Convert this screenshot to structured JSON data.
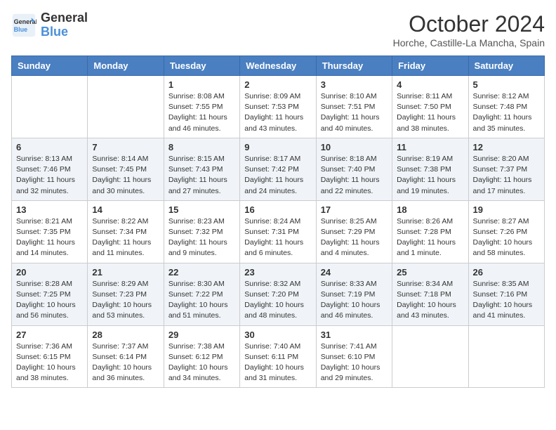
{
  "header": {
    "logo_line1": "General",
    "logo_line2": "Blue",
    "month_title": "October 2024",
    "location": "Horche, Castille-La Mancha, Spain"
  },
  "weekdays": [
    "Sunday",
    "Monday",
    "Tuesday",
    "Wednesday",
    "Thursday",
    "Friday",
    "Saturday"
  ],
  "weeks": [
    [
      {
        "day": "",
        "info": ""
      },
      {
        "day": "",
        "info": ""
      },
      {
        "day": "1",
        "info": "Sunrise: 8:08 AM\nSunset: 7:55 PM\nDaylight: 11 hours and 46 minutes."
      },
      {
        "day": "2",
        "info": "Sunrise: 8:09 AM\nSunset: 7:53 PM\nDaylight: 11 hours and 43 minutes."
      },
      {
        "day": "3",
        "info": "Sunrise: 8:10 AM\nSunset: 7:51 PM\nDaylight: 11 hours and 40 minutes."
      },
      {
        "day": "4",
        "info": "Sunrise: 8:11 AM\nSunset: 7:50 PM\nDaylight: 11 hours and 38 minutes."
      },
      {
        "day": "5",
        "info": "Sunrise: 8:12 AM\nSunset: 7:48 PM\nDaylight: 11 hours and 35 minutes."
      }
    ],
    [
      {
        "day": "6",
        "info": "Sunrise: 8:13 AM\nSunset: 7:46 PM\nDaylight: 11 hours and 32 minutes."
      },
      {
        "day": "7",
        "info": "Sunrise: 8:14 AM\nSunset: 7:45 PM\nDaylight: 11 hours and 30 minutes."
      },
      {
        "day": "8",
        "info": "Sunrise: 8:15 AM\nSunset: 7:43 PM\nDaylight: 11 hours and 27 minutes."
      },
      {
        "day": "9",
        "info": "Sunrise: 8:17 AM\nSunset: 7:42 PM\nDaylight: 11 hours and 24 minutes."
      },
      {
        "day": "10",
        "info": "Sunrise: 8:18 AM\nSunset: 7:40 PM\nDaylight: 11 hours and 22 minutes."
      },
      {
        "day": "11",
        "info": "Sunrise: 8:19 AM\nSunset: 7:38 PM\nDaylight: 11 hours and 19 minutes."
      },
      {
        "day": "12",
        "info": "Sunrise: 8:20 AM\nSunset: 7:37 PM\nDaylight: 11 hours and 17 minutes."
      }
    ],
    [
      {
        "day": "13",
        "info": "Sunrise: 8:21 AM\nSunset: 7:35 PM\nDaylight: 11 hours and 14 minutes."
      },
      {
        "day": "14",
        "info": "Sunrise: 8:22 AM\nSunset: 7:34 PM\nDaylight: 11 hours and 11 minutes."
      },
      {
        "day": "15",
        "info": "Sunrise: 8:23 AM\nSunset: 7:32 PM\nDaylight: 11 hours and 9 minutes."
      },
      {
        "day": "16",
        "info": "Sunrise: 8:24 AM\nSunset: 7:31 PM\nDaylight: 11 hours and 6 minutes."
      },
      {
        "day": "17",
        "info": "Sunrise: 8:25 AM\nSunset: 7:29 PM\nDaylight: 11 hours and 4 minutes."
      },
      {
        "day": "18",
        "info": "Sunrise: 8:26 AM\nSunset: 7:28 PM\nDaylight: 11 hours and 1 minute."
      },
      {
        "day": "19",
        "info": "Sunrise: 8:27 AM\nSunset: 7:26 PM\nDaylight: 10 hours and 58 minutes."
      }
    ],
    [
      {
        "day": "20",
        "info": "Sunrise: 8:28 AM\nSunset: 7:25 PM\nDaylight: 10 hours and 56 minutes."
      },
      {
        "day": "21",
        "info": "Sunrise: 8:29 AM\nSunset: 7:23 PM\nDaylight: 10 hours and 53 minutes."
      },
      {
        "day": "22",
        "info": "Sunrise: 8:30 AM\nSunset: 7:22 PM\nDaylight: 10 hours and 51 minutes."
      },
      {
        "day": "23",
        "info": "Sunrise: 8:32 AM\nSunset: 7:20 PM\nDaylight: 10 hours and 48 minutes."
      },
      {
        "day": "24",
        "info": "Sunrise: 8:33 AM\nSunset: 7:19 PM\nDaylight: 10 hours and 46 minutes."
      },
      {
        "day": "25",
        "info": "Sunrise: 8:34 AM\nSunset: 7:18 PM\nDaylight: 10 hours and 43 minutes."
      },
      {
        "day": "26",
        "info": "Sunrise: 8:35 AM\nSunset: 7:16 PM\nDaylight: 10 hours and 41 minutes."
      }
    ],
    [
      {
        "day": "27",
        "info": "Sunrise: 7:36 AM\nSunset: 6:15 PM\nDaylight: 10 hours and 38 minutes."
      },
      {
        "day": "28",
        "info": "Sunrise: 7:37 AM\nSunset: 6:14 PM\nDaylight: 10 hours and 36 minutes."
      },
      {
        "day": "29",
        "info": "Sunrise: 7:38 AM\nSunset: 6:12 PM\nDaylight: 10 hours and 34 minutes."
      },
      {
        "day": "30",
        "info": "Sunrise: 7:40 AM\nSunset: 6:11 PM\nDaylight: 10 hours and 31 minutes."
      },
      {
        "day": "31",
        "info": "Sunrise: 7:41 AM\nSunset: 6:10 PM\nDaylight: 10 hours and 29 minutes."
      },
      {
        "day": "",
        "info": ""
      },
      {
        "day": "",
        "info": ""
      }
    ]
  ]
}
